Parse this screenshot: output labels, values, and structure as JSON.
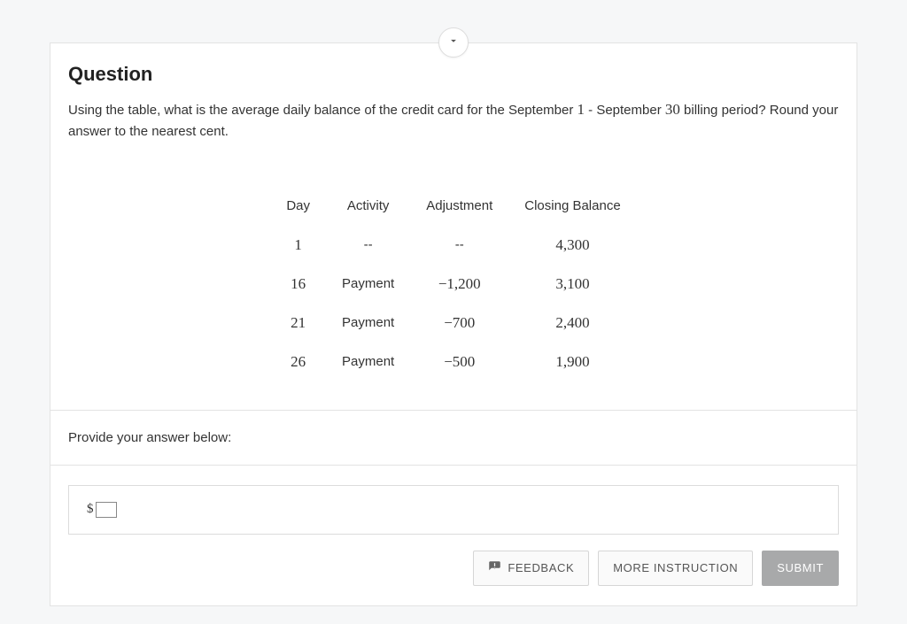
{
  "question": {
    "title": "Question",
    "text_pre": "Using the table, what is the average daily balance of the credit card for the September ",
    "num1": "1",
    "text_mid": " - September ",
    "num2": "30",
    "text_post": " billing period? Round your answer to the nearest cent."
  },
  "table": {
    "headers": {
      "c1": "Day",
      "c2": "Activity",
      "c3": "Adjustment",
      "c4": "Closing Balance"
    },
    "rows": [
      {
        "day": "1",
        "activity": "--",
        "adjustment": "--",
        "balance": "4,300"
      },
      {
        "day": "16",
        "activity": "Payment",
        "adjustment": "−1,200",
        "balance": "3,100"
      },
      {
        "day": "21",
        "activity": "Payment",
        "adjustment": "−700",
        "balance": "2,400"
      },
      {
        "day": "26",
        "activity": "Payment",
        "adjustment": "−500",
        "balance": "1,900"
      }
    ]
  },
  "prompt": "Provide your answer below:",
  "answer": {
    "currency": "$",
    "value": ""
  },
  "buttons": {
    "feedback": "FEEDBACK",
    "more": "MORE INSTRUCTION",
    "submit": "SUBMIT"
  }
}
